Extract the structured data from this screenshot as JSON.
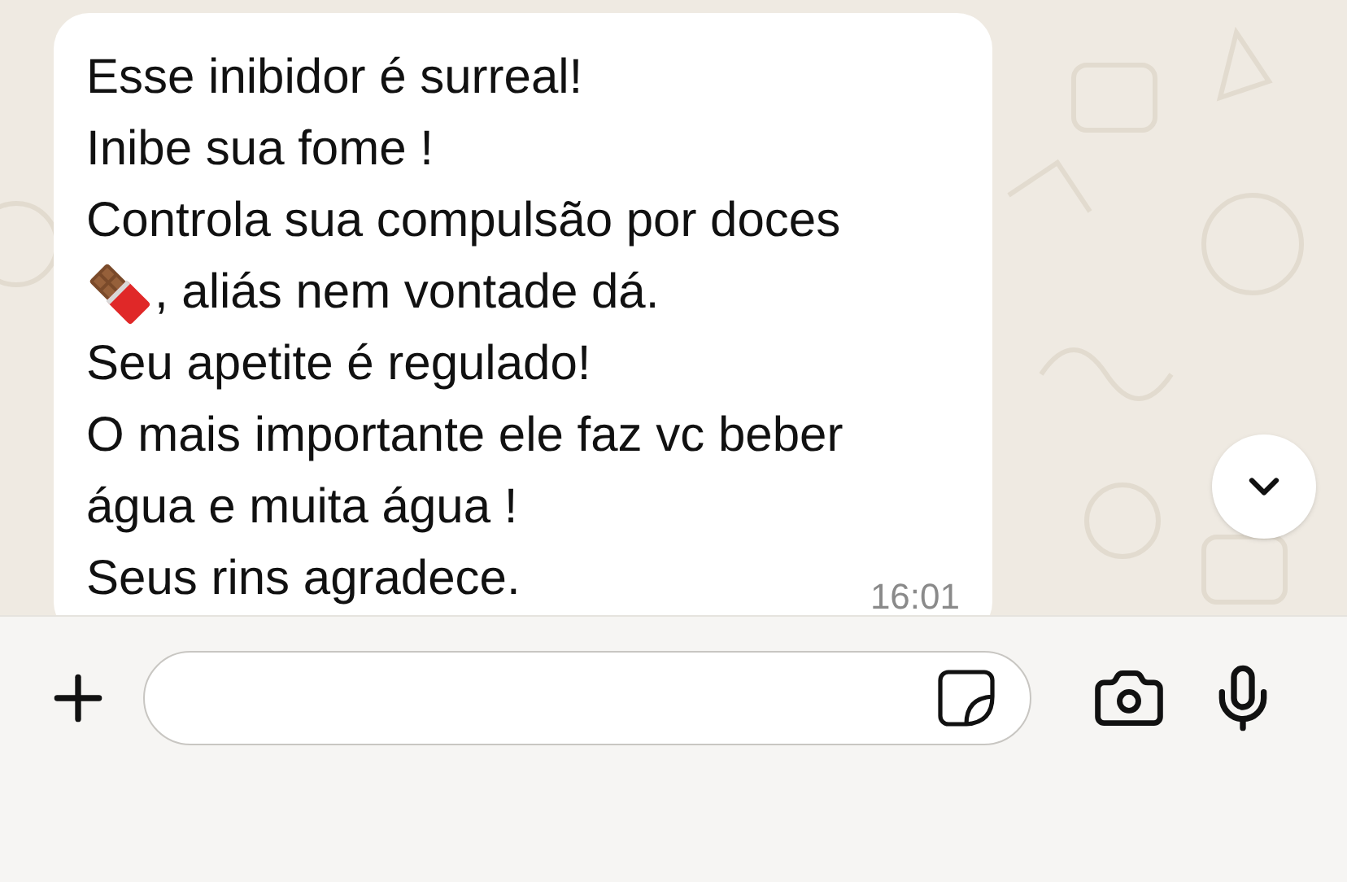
{
  "message": {
    "lines": [
      {
        "kind": "text",
        "text": "Esse inibidor é surreal!"
      },
      {
        "kind": "text",
        "text": "Inibe sua fome !"
      },
      {
        "kind": "text",
        "text": "Controla sua compulsão por doces"
      },
      {
        "kind": "emoji",
        "text": ", aliás nem vontade dá."
      },
      {
        "kind": "text",
        "text": "Seu apetite é regulado!"
      },
      {
        "kind": "text",
        "text": "O mais importante ele faz vc beber"
      },
      {
        "kind": "text",
        "text": "água e muita água !"
      },
      {
        "kind": "text",
        "text": "Seus rins agradece."
      }
    ],
    "time": "16:01"
  }
}
